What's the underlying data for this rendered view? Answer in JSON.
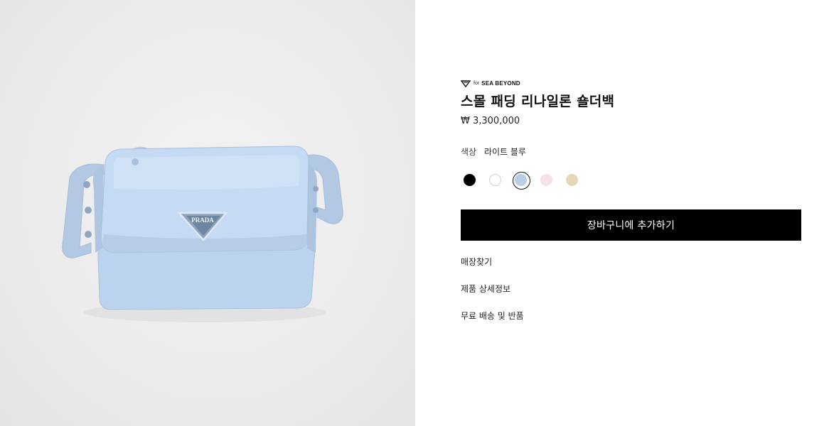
{
  "product_image": {
    "logo_text": "PRADA",
    "bag_color": "#bcd3ee"
  },
  "brand": {
    "small_text": "for",
    "main_text": "SEA BEYOND",
    "icon": "sea-beyond-heart-icon"
  },
  "product": {
    "title": "스몰 패딩 리나일론 숄더백",
    "price": "₩ 3,300,000"
  },
  "color": {
    "label": "색상",
    "value": "라이트 블루",
    "swatches": [
      {
        "name": "black",
        "hex": "#000000",
        "selected": false
      },
      {
        "name": "white",
        "hex": "#ffffff",
        "selected": false
      },
      {
        "name": "light-blue",
        "hex": "#b9cde6",
        "selected": true
      },
      {
        "name": "pink",
        "hex": "#f6e1ea",
        "selected": false
      },
      {
        "name": "beige",
        "hex": "#e6d7b7",
        "selected": false
      }
    ]
  },
  "actions": {
    "add_to_cart": "장바구니에 추가하기"
  },
  "links": {
    "find_store": "매장찾기",
    "product_details": "제품 상세정보",
    "shipping_returns": "무료 배송 및 반품"
  }
}
